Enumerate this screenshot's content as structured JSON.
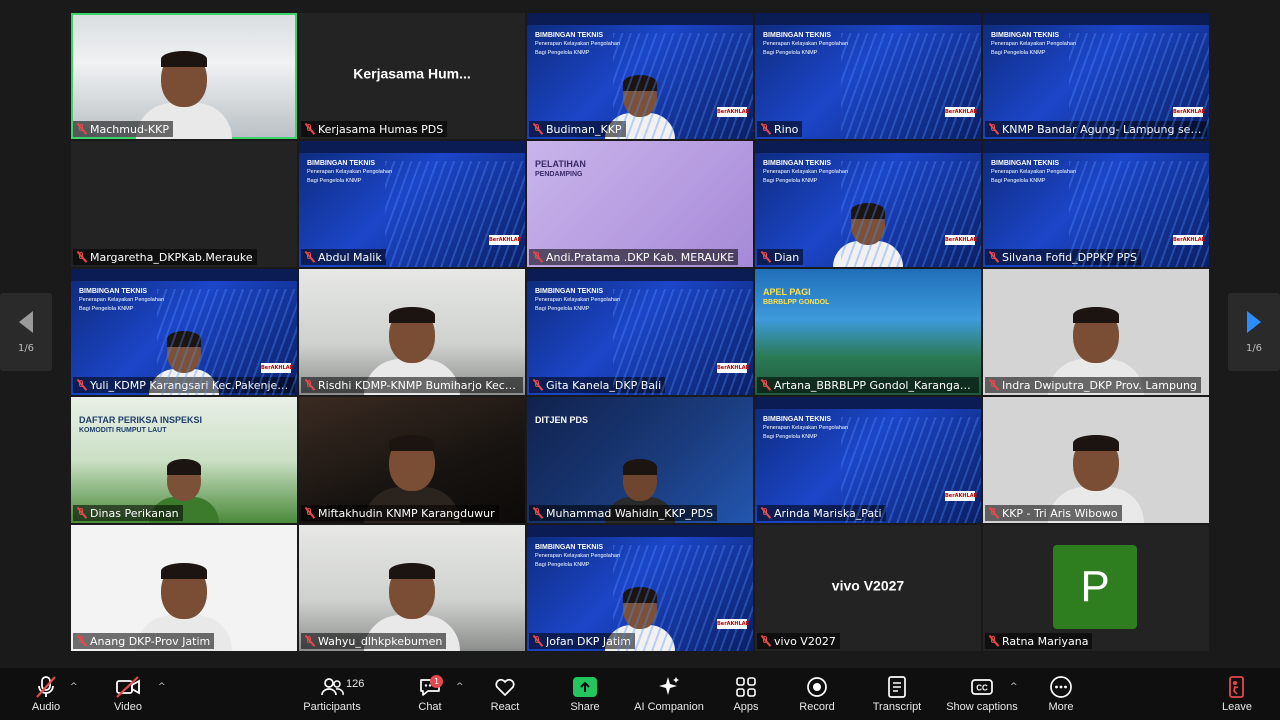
{
  "meeting": {
    "tiles": [
      {
        "name": "Machmud-KKP",
        "type": "video",
        "bg": "room",
        "active": true
      },
      {
        "name": "Kerjasama Humas PDS",
        "type": "name-only",
        "display_text": "Kerjasama  Hum..."
      },
      {
        "name": "Budiman_KKP",
        "type": "slide-person"
      },
      {
        "name": "Rino",
        "type": "slide"
      },
      {
        "name": "KNMP Bandar Agung- Lampung selat...",
        "type": "slide"
      },
      {
        "name": "Margaretha_DKPKab.Merauke",
        "type": "blank"
      },
      {
        "name": "Abdul Malik",
        "type": "slide"
      },
      {
        "name": "Andi.Pratama .DKP Kab. MERAUKE",
        "type": "purple"
      },
      {
        "name": "Dian",
        "type": "slide-person"
      },
      {
        "name": "Silvana Fofid_DPPKP PPS",
        "type": "slide"
      },
      {
        "name": "Yuli_KDMP Karangsari Kec.Pakenjeng ...",
        "type": "slide-person"
      },
      {
        "name": "Risdhi KDMP-KNMP Bumiharjo Kecam...",
        "type": "video",
        "bg": "room2"
      },
      {
        "name": "Gita Kanela_DKP Bali",
        "type": "slide"
      },
      {
        "name": "Artana_BBRBLPP Gondol_Karangasem",
        "type": "coast"
      },
      {
        "name": "Indra Dwiputra_DKP Prov. Lampung",
        "type": "video",
        "bg": "grey"
      },
      {
        "name": "Dinas Perikanan",
        "type": "green"
      },
      {
        "name": "Miftakhudin KNMP Karangduwur",
        "type": "video",
        "bg": "dark"
      },
      {
        "name": "Muhammad Wahidin_KKP_PDS",
        "type": "tech"
      },
      {
        "name": "Arinda Mariska_Pati",
        "type": "slide"
      },
      {
        "name": "KKP - Tri Aris Wibowo",
        "type": "video",
        "bg": "grey"
      },
      {
        "name": "Anang DKP-Prov Jatim",
        "type": "video",
        "bg": "white"
      },
      {
        "name": "Wahyu_dlhkpkebumen",
        "type": "video",
        "bg": "room2"
      },
      {
        "name": "Jofan DKP Jatim",
        "type": "slide-person"
      },
      {
        "name": "vivo V2027",
        "type": "name-only",
        "display_text": "vivo V2027"
      },
      {
        "name": "Ratna Mariyana",
        "type": "avatar",
        "initial": "P"
      }
    ],
    "slide_title": "BIMBINGAN TEKNIS",
    "slide_sub1": "Penerapan Kelayakan Pengolahan",
    "slide_sub2": "Bagi Pengelola KNMP",
    "slide_badge": "BerAKHLAK",
    "purple_title": "PELATIHAN",
    "purple_sub": "PENDAMPING",
    "coast_title": "APEL PAGI",
    "coast_sub": "BBRBLPP GONDOL",
    "tech_title": "DITJEN PDS",
    "green_title": "DAFTAR PERIKSA INSPEKSI",
    "green_sub": "KOMODITI RUMPUT LAUT"
  },
  "pager": {
    "left_count": "1/6",
    "right_count": "1/6"
  },
  "toolbar": {
    "audio": "Audio",
    "video": "Video",
    "participants": "Participants",
    "participants_count": "126",
    "chat": "Chat",
    "chat_badge": "1",
    "react": "React",
    "share": "Share",
    "ai_companion": "AI Companion",
    "apps": "Apps",
    "record": "Record",
    "transcript": "Transcript",
    "show_captions": "Show captions",
    "more": "More",
    "leave": "Leave"
  },
  "colors": {
    "active_speaker": "#3fd16a",
    "muted": "#e5484d",
    "share": "#22c55e",
    "leave": "#e5484d",
    "pager_active": "#2d8cff"
  }
}
